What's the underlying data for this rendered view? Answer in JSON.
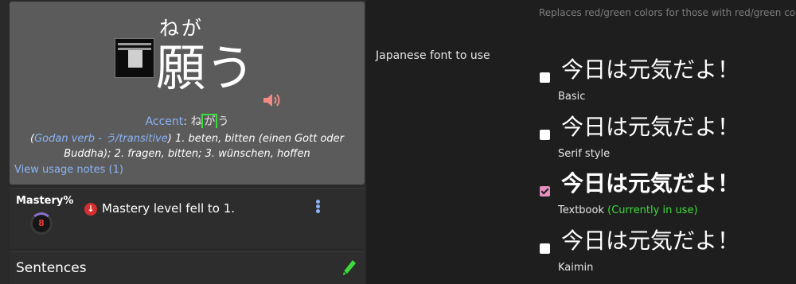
{
  "vocab": {
    "reading": "ねが",
    "word": "願う",
    "accent_label": "Accent",
    "accent_before": "ね",
    "accent_marked": "が",
    "accent_after": "う",
    "definition_pos": "Godan verb - う/transitive",
    "definition_text": "1. beten, bitten (einen Gott oder Buddha); 2. fragen, bitten; 3. wünschen, hoffen",
    "usage_link": "View usage notes (1)"
  },
  "mastery": {
    "label": "Mastery%",
    "level": "8",
    "message": "Mastery level fell to 1."
  },
  "sentences": {
    "title": "Sentences"
  },
  "settings": {
    "top_note": "Replaces red/green colors for those with red/green colo",
    "font_label": "Japanese font to use",
    "sample_text": "今日は元気だよ！",
    "in_use_text": "(Currently in use)",
    "options": [
      {
        "name": "Basic",
        "checked": false
      },
      {
        "name": "Serif style",
        "checked": false
      },
      {
        "name": "Textbook",
        "checked": true
      },
      {
        "name": "Kaimin",
        "checked": false
      }
    ]
  },
  "colors": {
    "accent_blue": "#8ab4f8",
    "in_use_green": "#3ddc3d",
    "checkbox_pink": "#e28fbe",
    "mastery_red": "#e53935"
  }
}
